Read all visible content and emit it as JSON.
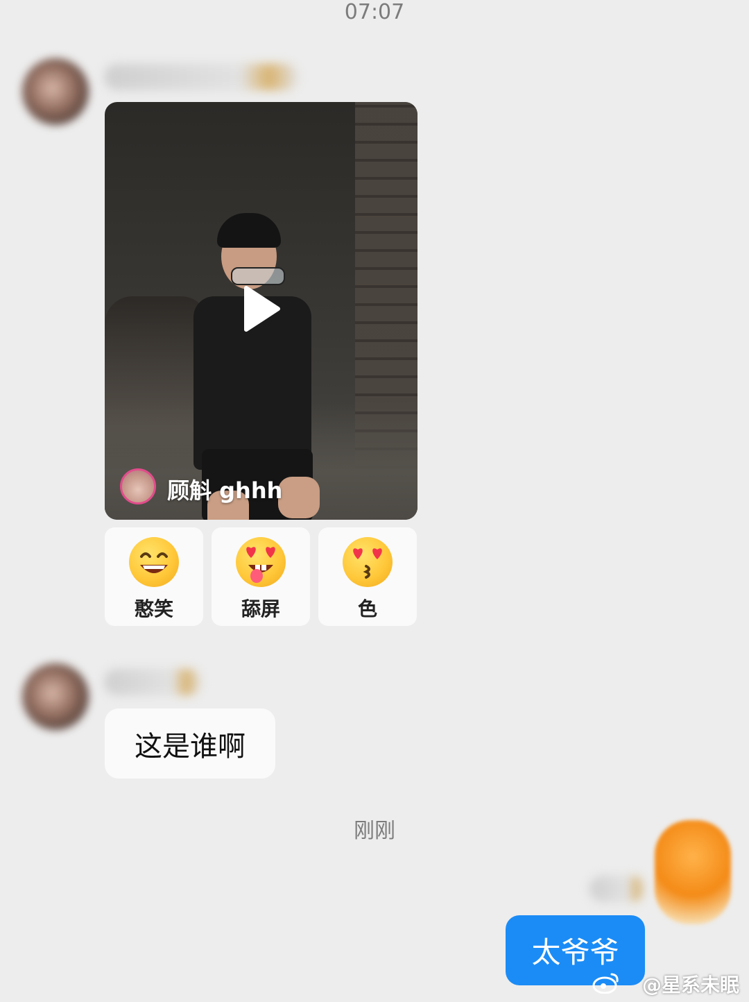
{
  "header": {
    "time": "07:07"
  },
  "messages": [
    {
      "type": "video",
      "author_name": "顾斛 ghhh",
      "reactions": [
        {
          "label": "憨笑",
          "emoji": "grin-emoji"
        },
        {
          "label": "舔屏",
          "emoji": "heart-eyes-tongue-emoji"
        },
        {
          "label": "色",
          "emoji": "heart-eyes-kiss-emoji"
        }
      ]
    },
    {
      "type": "text",
      "text": "这是谁啊"
    }
  ],
  "divider": {
    "time": "刚刚"
  },
  "outgoing": {
    "text": "太爷爷"
  },
  "watermark": {
    "text": "@星系未眠"
  },
  "colors": {
    "background": "#ededed",
    "outgoing_bubble": "#1b8cf6",
    "incoming_bubble": "#fafafa"
  }
}
